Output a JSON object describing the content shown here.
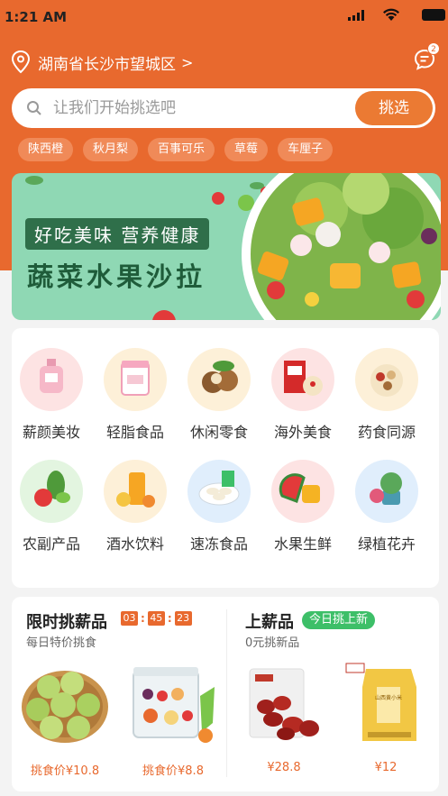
{
  "status_bar": {
    "time": "1:21 AM"
  },
  "location": {
    "address": "湖南省长沙市望城区",
    "chevron": ">"
  },
  "messages": {
    "badge_count": "2"
  },
  "search": {
    "placeholder": "让我们开始挑选吧",
    "button_label": "挑选"
  },
  "hot_tags": [
    "陕西橙",
    "秋月梨",
    "百事可乐",
    "草莓",
    "车厘子"
  ],
  "banner": {
    "slogan": "好吃美味  营养健康",
    "title": "蔬菜水果沙拉"
  },
  "categories": [
    {
      "label": "薪颜美妆",
      "icon": "perfume-icon",
      "bg": "#fde3e3"
    },
    {
      "label": "轻脂食品",
      "icon": "supplement-jar-icon",
      "bg": "#fdf0d8"
    },
    {
      "label": "休闲零食",
      "icon": "macadamia-nut-icon",
      "bg": "#fdf0d8"
    },
    {
      "label": "海外美食",
      "icon": "cereal-box-icon",
      "bg": "#fde3e3"
    },
    {
      "label": "药食同源",
      "icon": "herbal-bowl-icon",
      "bg": "#fdf0d8"
    },
    {
      "label": "农副产品",
      "icon": "vegetables-icon",
      "bg": "#e3f5e0"
    },
    {
      "label": "酒水饮料",
      "icon": "juice-glass-icon",
      "bg": "#fdf0d8"
    },
    {
      "label": "速冻食品",
      "icon": "dumplings-icon",
      "bg": "#e0eefc"
    },
    {
      "label": "水果生鲜",
      "icon": "watermelon-mango-icon",
      "bg": "#fde3e3"
    },
    {
      "label": "绿植花卉",
      "icon": "potted-plant-icon",
      "bg": "#e0eefc"
    }
  ],
  "flash_sale": {
    "title": "限时挑薪品",
    "subtitle": "每日特价挑食",
    "timer": {
      "hours": "03",
      "minutes": "45",
      "seconds": "23"
    },
    "products": [
      {
        "image": "pear-basket-image",
        "price": "挑食价¥10.8"
      },
      {
        "image": "fruit-box-image",
        "price": "挑食价¥8.8"
      }
    ]
  },
  "new_arrivals": {
    "title": "上薪品",
    "badge": "今日挑上新",
    "subtitle": "0元挑新品",
    "products": [
      {
        "image": "red-dates-bag-image",
        "price": "¥28.8"
      },
      {
        "image": "millet-bag-image",
        "price": "¥12",
        "package_text": "山西黄小米"
      }
    ]
  },
  "colors": {
    "brand": "#e8692e",
    "accent_button": "#eb7a33",
    "green_badge": "#3dbf68",
    "banner_green": "#2f6f4a"
  }
}
